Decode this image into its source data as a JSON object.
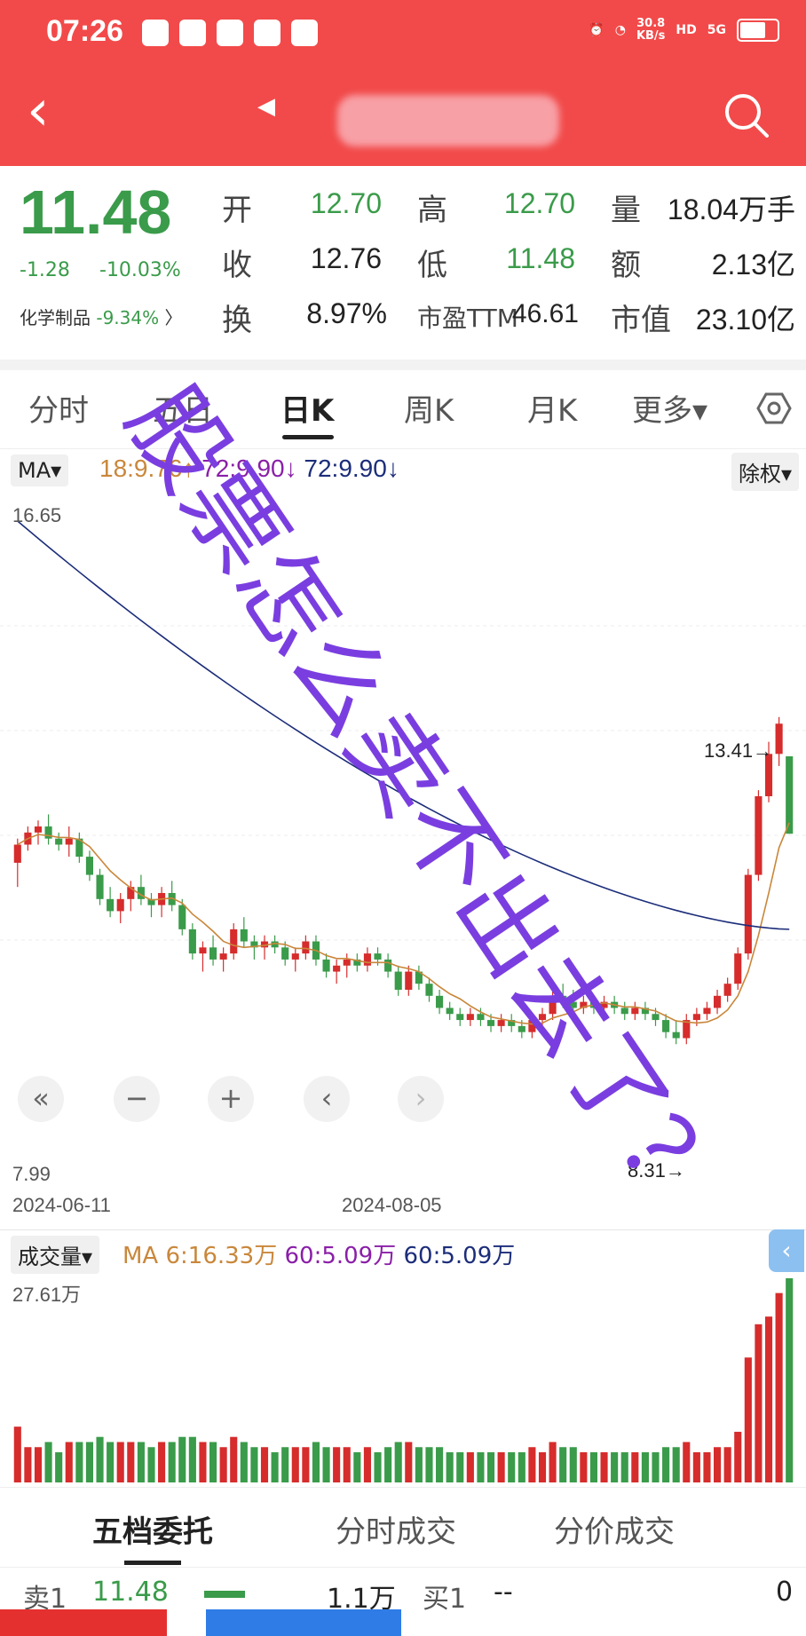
{
  "status_bar": {
    "time": "07:26",
    "net_speed_value": "30.8",
    "net_speed_unit": "KB/s",
    "hd": "HD",
    "signal": "5G"
  },
  "quote": {
    "price": "11.48",
    "change": "-1.28",
    "change_pct": "-10.03%",
    "sector_name": "化学制品",
    "sector_pct": "-9.34%",
    "open_label": "开",
    "open": "12.70",
    "high_label": "高",
    "high": "12.70",
    "volume_label": "量",
    "volume": "18.04万手",
    "close_label": "收",
    "prev_close": "12.76",
    "low_label": "低",
    "low": "11.48",
    "amount_label": "额",
    "amount": "2.13亿",
    "turnover_label": "换",
    "turnover": "8.97%",
    "pe_label": "市盈TTM",
    "pe": "46.61",
    "mcap_label": "市值",
    "mcap": "23.10亿"
  },
  "tabs": [
    "分时",
    "五日",
    "日K",
    "周K",
    "月K",
    "更多▾"
  ],
  "ma_bar": {
    "button": "MA▾",
    "ma1": "18:9.76↑",
    "ma2": "72:9.90↓",
    "ma3": "72:9.90↓",
    "fq_button": "除权▾"
  },
  "chart": {
    "y_max_label": "16.65",
    "y_min_label": "7.99",
    "date_start": "2024-06-11",
    "date_mid": "2024-08-05",
    "high_marker": "13.41→",
    "low_marker": "8.31→"
  },
  "controls": [
    "«",
    "−",
    "+",
    "‹",
    "›"
  ],
  "volume_bar": {
    "button": "成交量▾",
    "ma1": "MA 6:16.33万",
    "ma2": "60:5.09万",
    "ma3": "60:5.09万",
    "max_label": "27.61万",
    "side_button": "‹"
  },
  "bottom_tabs": [
    "五档委托",
    "分时成交",
    "分价成交"
  ],
  "order_book": {
    "sell_label": "卖1",
    "sell_price": "11.48",
    "sell_vol": "1.1万",
    "buy_label": "买1",
    "buy_price": "--",
    "buy_vol": "0"
  },
  "watermark_text": "股票怎么卖不出去了？",
  "colors": {
    "up": "#d62c2c",
    "down": "#3a9b4a",
    "ma_orange": "#c9873b",
    "ma_navy": "#1c2d7a",
    "header_red": "#f24a4a",
    "watermark": "#7a3ee0"
  },
  "chart_data": {
    "type": "candlestick",
    "date_start": "2024-06-11",
    "date_mid": "2024-08-05",
    "ylim": [
      7.99,
      16.65
    ],
    "marked_high": 13.41,
    "marked_low": 8.31,
    "candles_ohlc": [
      [
        11.0,
        11.4,
        10.6,
        11.3
      ],
      [
        11.3,
        11.6,
        11.2,
        11.5
      ],
      [
        11.5,
        11.7,
        11.3,
        11.6
      ],
      [
        11.6,
        11.8,
        11.3,
        11.4
      ],
      [
        11.4,
        11.5,
        11.2,
        11.3
      ],
      [
        11.3,
        11.6,
        11.1,
        11.4
      ],
      [
        11.4,
        11.5,
        11.0,
        11.1
      ],
      [
        11.1,
        11.2,
        10.7,
        10.8
      ],
      [
        10.8,
        10.9,
        10.3,
        10.4
      ],
      [
        10.4,
        10.6,
        10.1,
        10.2
      ],
      [
        10.2,
        10.5,
        10.0,
        10.4
      ],
      [
        10.4,
        10.7,
        10.2,
        10.6
      ],
      [
        10.6,
        10.8,
        10.3,
        10.4
      ],
      [
        10.4,
        10.5,
        10.1,
        10.3
      ],
      [
        10.3,
        10.6,
        10.1,
        10.5
      ],
      [
        10.5,
        10.7,
        10.2,
        10.3
      ],
      [
        10.3,
        10.4,
        9.8,
        9.9
      ],
      [
        9.9,
        10.0,
        9.4,
        9.5
      ],
      [
        9.5,
        9.7,
        9.2,
        9.6
      ],
      [
        9.6,
        9.8,
        9.3,
        9.4
      ],
      [
        9.4,
        9.6,
        9.2,
        9.5
      ],
      [
        9.5,
        10.0,
        9.4,
        9.9
      ],
      [
        9.9,
        10.1,
        9.6,
        9.7
      ],
      [
        9.7,
        9.8,
        9.4,
        9.6
      ],
      [
        9.6,
        9.8,
        9.4,
        9.7
      ],
      [
        9.7,
        9.8,
        9.5,
        9.6
      ],
      [
        9.6,
        9.7,
        9.3,
        9.4
      ],
      [
        9.4,
        9.6,
        9.2,
        9.5
      ],
      [
        9.5,
        9.8,
        9.4,
        9.7
      ],
      [
        9.7,
        9.8,
        9.3,
        9.4
      ],
      [
        9.4,
        9.5,
        9.1,
        9.2
      ],
      [
        9.2,
        9.4,
        9.0,
        9.3
      ],
      [
        9.3,
        9.5,
        9.1,
        9.4
      ],
      [
        9.4,
        9.5,
        9.2,
        9.3
      ],
      [
        9.3,
        9.6,
        9.2,
        9.5
      ],
      [
        9.5,
        9.6,
        9.3,
        9.4
      ],
      [
        9.4,
        9.5,
        9.1,
        9.2
      ],
      [
        9.2,
        9.3,
        8.8,
        8.9
      ],
      [
        8.9,
        9.3,
        8.8,
        9.2
      ],
      [
        9.2,
        9.3,
        8.9,
        9.0
      ],
      [
        9.0,
        9.1,
        8.7,
        8.8
      ],
      [
        8.8,
        8.9,
        8.5,
        8.6
      ],
      [
        8.6,
        8.7,
        8.4,
        8.5
      ],
      [
        8.5,
        8.6,
        8.3,
        8.4
      ],
      [
        8.4,
        8.6,
        8.3,
        8.5
      ],
      [
        8.5,
        8.6,
        8.3,
        8.4
      ],
      [
        8.4,
        8.5,
        8.2,
        8.3
      ],
      [
        8.3,
        8.5,
        8.2,
        8.4
      ],
      [
        8.4,
        8.5,
        8.2,
        8.3
      ],
      [
        8.3,
        8.4,
        8.1,
        8.2
      ],
      [
        8.2,
        8.5,
        8.1,
        8.4
      ],
      [
        8.4,
        8.6,
        8.3,
        8.5
      ],
      [
        8.5,
        8.9,
        8.4,
        8.8
      ],
      [
        8.8,
        9.0,
        8.6,
        8.7
      ],
      [
        8.7,
        8.9,
        8.5,
        8.6
      ],
      [
        8.6,
        8.8,
        8.5,
        8.7
      ],
      [
        8.7,
        8.8,
        8.5,
        8.6
      ],
      [
        8.6,
        8.8,
        8.5,
        8.7
      ],
      [
        8.7,
        8.8,
        8.5,
        8.6
      ],
      [
        8.6,
        8.7,
        8.4,
        8.5
      ],
      [
        8.5,
        8.7,
        8.4,
        8.6
      ],
      [
        8.6,
        8.7,
        8.4,
        8.5
      ],
      [
        8.5,
        8.6,
        8.3,
        8.4
      ],
      [
        8.4,
        8.5,
        8.1,
        8.2
      ],
      [
        8.2,
        8.4,
        8.0,
        8.1
      ],
      [
        8.1,
        8.5,
        8.0,
        8.4
      ],
      [
        8.4,
        8.6,
        8.3,
        8.5
      ],
      [
        8.5,
        8.7,
        8.4,
        8.6
      ],
      [
        8.6,
        8.9,
        8.5,
        8.8
      ],
      [
        8.8,
        9.1,
        8.7,
        9.0
      ],
      [
        9.0,
        9.6,
        8.9,
        9.5
      ],
      [
        9.5,
        10.9,
        9.4,
        10.8
      ],
      [
        10.8,
        12.2,
        10.7,
        12.1
      ],
      [
        12.1,
        13.0,
        12.0,
        12.8
      ],
      [
        12.8,
        13.41,
        12.6,
        13.3
      ],
      [
        12.76,
        12.7,
        11.48,
        11.48
      ]
    ],
    "ma_long_endpoints": [
      16.65,
      9.9
    ],
    "volume_max": 27.61
  }
}
